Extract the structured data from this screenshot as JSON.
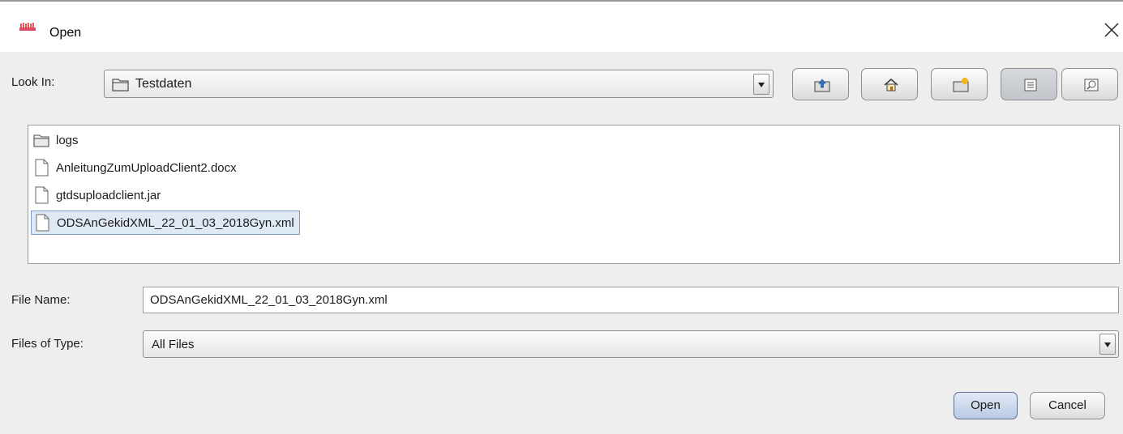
{
  "window": {
    "title": "Open",
    "title_icon": "app-icon",
    "close_icon": "close-icon"
  },
  "look_in": {
    "label": "Look In:",
    "value": "Testdaten",
    "icon": "folder-icon"
  },
  "toolbar": [
    {
      "name": "up-one-level-button",
      "icon": "folder-up-icon"
    },
    {
      "name": "home-button",
      "icon": "home-icon"
    },
    {
      "name": "new-folder-button",
      "icon": "new-folder-icon"
    },
    {
      "name": "list-view-button",
      "icon": "list-view-icon",
      "active": true
    },
    {
      "name": "details-view-button",
      "icon": "details-view-icon"
    }
  ],
  "files": [
    {
      "name": "logs",
      "type": "folder"
    },
    {
      "name": "AnleitungZumUploadClient2.docx",
      "type": "file"
    },
    {
      "name": "gtdsuploadclient.jar",
      "type": "file"
    },
    {
      "name": "ODSAnGekidXML_22_01_03_2018Gyn.xml",
      "type": "file",
      "selected": true
    }
  ],
  "file_name": {
    "label": "File Name:",
    "value": "ODSAnGekidXML_22_01_03_2018Gyn.xml"
  },
  "file_type": {
    "label": "Files of Type:",
    "value": "All Files"
  },
  "buttons": {
    "open": "Open",
    "cancel": "Cancel"
  },
  "colors": {
    "selection_bg": "#dfe8f5",
    "selection_border": "#7b9bd1",
    "default_button": "#b8c9e3"
  }
}
